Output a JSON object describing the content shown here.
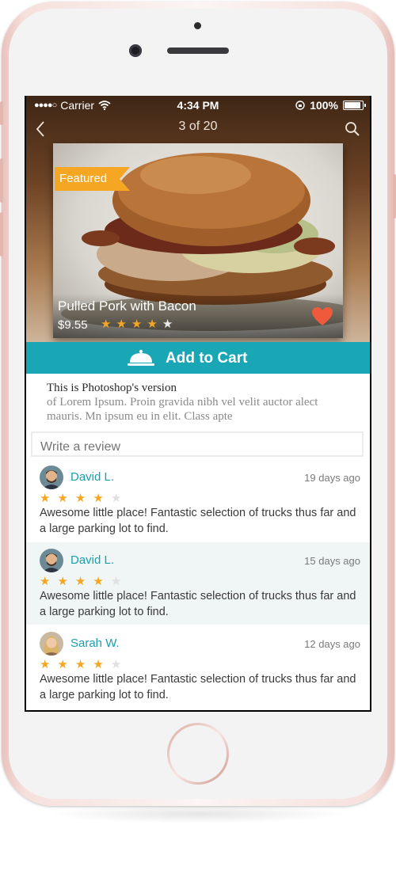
{
  "status_bar": {
    "carrier": "Carrier",
    "time": "4:34 PM",
    "battery": "100%"
  },
  "nav": {
    "title": "3 of 20",
    "back_icon": "chevron-left-icon",
    "search_icon": "search-icon"
  },
  "product": {
    "badge": "Featured",
    "name": "Pulled Pork with Bacon",
    "price": "$9.55",
    "rating": 4,
    "rating_max": 5,
    "favorite": true
  },
  "cart": {
    "label": "Add to Cart",
    "icon": "cloche-icon"
  },
  "description": {
    "title": "This is Photoshop's version",
    "body": "of Lorem Ipsum. Proin gravida nibh vel velit auctor alect mauris. Mn ipsum eu in elit. Class apte"
  },
  "review_input": {
    "placeholder": "Write a review"
  },
  "reviews": [
    {
      "name": "David L.",
      "date": "19 days ago",
      "rating": 4,
      "text": "Awesome little place! Fantastic selection of trucks thus far and a large parking lot to find."
    },
    {
      "name": "David L.",
      "date": "15 days ago",
      "rating": 4,
      "text": "Awesome little place! Fantastic selection of trucks thus far and a large parking lot to find."
    },
    {
      "name": "Sarah W.",
      "date": "12 days ago",
      "rating": 4,
      "text": "Awesome little place! Fantastic selection of trucks thus far and a large parking lot to find."
    }
  ],
  "colors": {
    "accent": "#1aa7b5",
    "star": "#f5a623",
    "badge": "#f5a623",
    "heart": "#f05a3c"
  }
}
